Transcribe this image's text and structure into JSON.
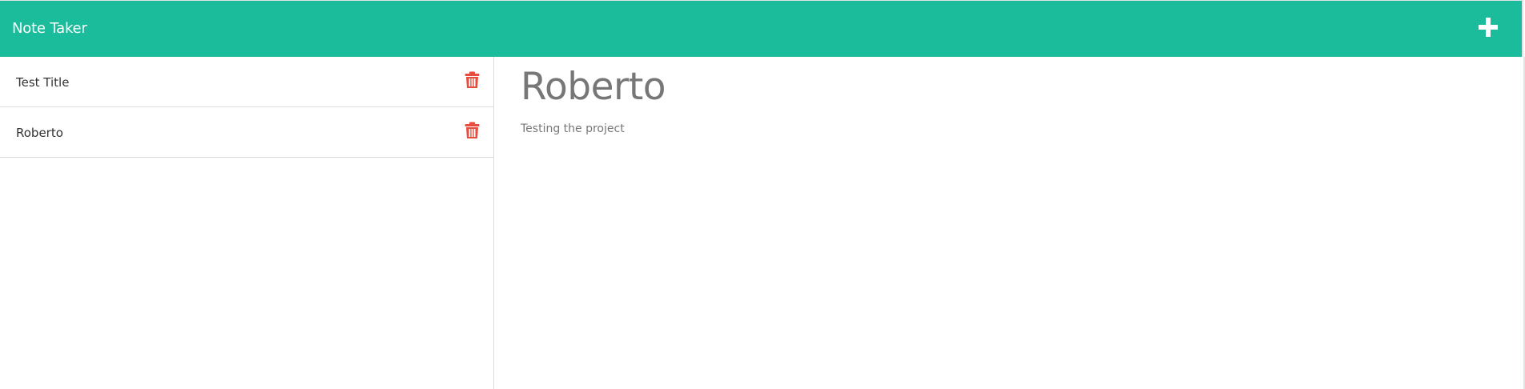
{
  "navbar": {
    "brand": "Note Taker",
    "new_note_icon": "plus-icon",
    "background_color": "#1abc9c"
  },
  "sidebar": {
    "notes": [
      {
        "title": "Test Title",
        "delete_icon": "trash-icon"
      },
      {
        "title": "Roberto",
        "delete_icon": "trash-icon"
      }
    ]
  },
  "main": {
    "note_title": "Roberto",
    "note_text": "Testing the project"
  },
  "colors": {
    "accent": "#1abc9c",
    "danger": "#e74c3c",
    "muted_text": "#777777"
  }
}
